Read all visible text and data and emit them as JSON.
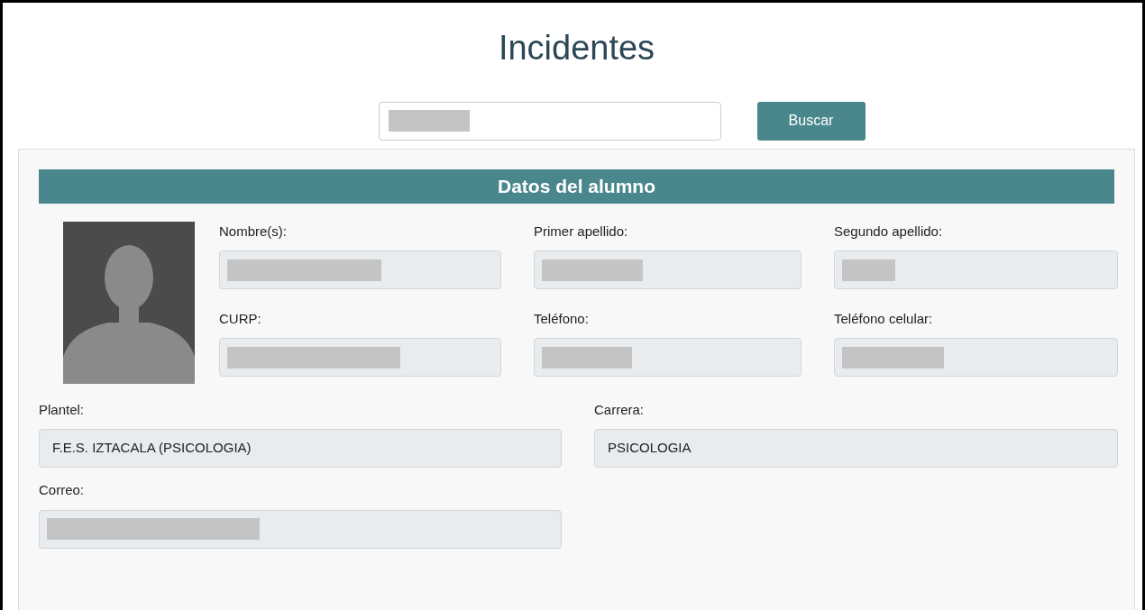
{
  "title": "Incidentes",
  "search": {
    "redacted": true,
    "button": "Buscar"
  },
  "section": {
    "title": "Datos del alumno"
  },
  "photo_fields": [
    {
      "label": "Nombre(s):",
      "redacted": true
    },
    {
      "label": "Primer apellido:",
      "redacted": true
    },
    {
      "label": "Segundo apellido:",
      "redacted": true
    },
    {
      "label": "CURP:",
      "redacted": true
    },
    {
      "label": "Teléfono:",
      "redacted": true
    },
    {
      "label": "Teléfono celular:",
      "redacted": true
    }
  ],
  "fields": [
    {
      "label": "Plantel:",
      "value": "F.E.S. IZTACALA (PSICOLOGIA)",
      "redacted": false
    },
    {
      "label": "Carrera:",
      "value": "PSICOLOGIA",
      "redacted": false
    },
    {
      "label": "Correo:",
      "redacted": true
    }
  ]
}
